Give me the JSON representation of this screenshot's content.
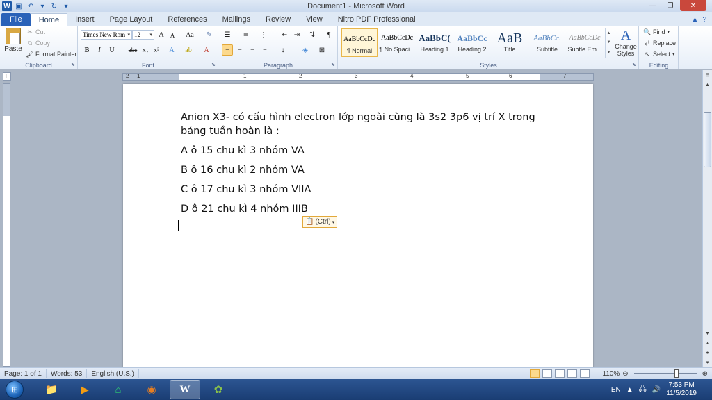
{
  "window": {
    "title": "Document1 - Microsoft Word",
    "logo_letter": "W"
  },
  "tabs": [
    {
      "label": "File"
    },
    {
      "label": "Home"
    },
    {
      "label": "Insert"
    },
    {
      "label": "Page Layout"
    },
    {
      "label": "References"
    },
    {
      "label": "Mailings"
    },
    {
      "label": "Review"
    },
    {
      "label": "View"
    },
    {
      "label": "Nitro PDF Professional"
    }
  ],
  "ribbon": {
    "clipboard": {
      "label": "Clipboard",
      "paste": "Paste",
      "cut": "Cut",
      "copy": "Copy",
      "format_painter": "Format Painter"
    },
    "font": {
      "label": "Font",
      "font_name": "Times New Rom",
      "font_size": "12",
      "bold": "B",
      "italic": "I",
      "underline": "U",
      "strikethrough": "abc",
      "subscript": "x₂",
      "superscript": "x²",
      "grow": "A",
      "shrink": "A",
      "change_case": "Aa"
    },
    "paragraph": {
      "label": "Paragraph"
    },
    "styles": {
      "label": "Styles",
      "items": [
        {
          "sample": "AaBbCcDc",
          "name": "¶ Normal"
        },
        {
          "sample": "AaBbCcDc",
          "name": "¶ No Spaci..."
        },
        {
          "sample": "AaBbC(",
          "name": "Heading 1"
        },
        {
          "sample": "AaBbCc",
          "name": "Heading 2"
        },
        {
          "sample": "AaB",
          "name": "Title"
        },
        {
          "sample": "AaBbCc.",
          "name": "Subtitle"
        },
        {
          "sample": "AaBbCcDc",
          "name": "Subtle Em..."
        }
      ],
      "change_styles": "Change Styles"
    },
    "editing": {
      "label": "Editing",
      "find": "Find",
      "replace": "Replace",
      "select": "Select"
    }
  },
  "ruler": {
    "ticks": [
      "2",
      "1",
      "1",
      "2",
      "3",
      "4",
      "5",
      "6",
      "7"
    ]
  },
  "document": {
    "paragraphs": [
      "Anion X3- có cấu hình electron lớp ngoài cùng là 3s2 3p6 vị trí X trong bảng tuần hoàn là :",
      "A ô 15 chu kì 3 nhóm VA",
      "B ô 16 chu kì 2 nhóm VA",
      "C ô 17 chu kì 3 nhóm VIIA",
      "D ô 21 chu kì 4 nhóm IIIB"
    ],
    "paste_options": "(Ctrl)"
  },
  "status": {
    "page": "Page: 1 of 1",
    "words": "Words: 53",
    "language": "English (U.S.)",
    "zoom": "110%"
  },
  "taskbar": {
    "language": "EN",
    "time": "7:53 PM",
    "date": "11/5/2019"
  },
  "colors": {
    "file_tab": "#2a62b8",
    "selected_style": "#fcd98d",
    "taskbar": "#1a3d73"
  }
}
